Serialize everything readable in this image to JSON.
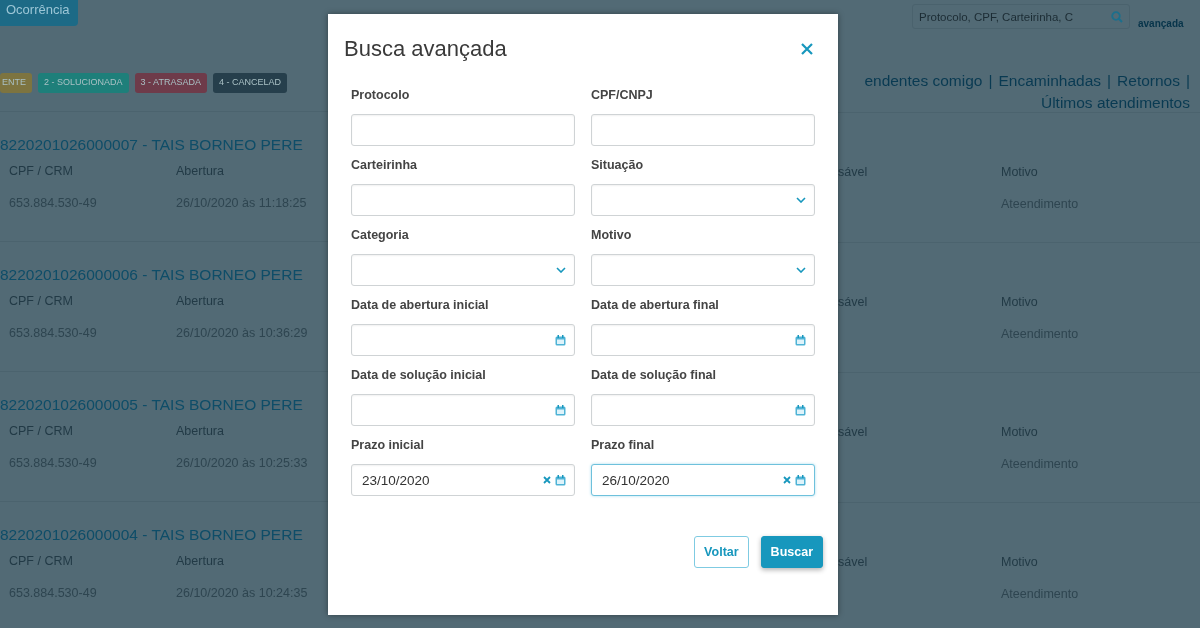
{
  "page": {
    "new_button": "Ocorrência",
    "badges": [
      {
        "label": "ENTE",
        "color": "#7d7440"
      },
      {
        "label": "2 - SOLUCIONADA",
        "color": "#1e7f7a"
      },
      {
        "label": "3 - ATRASADA",
        "color": "#6e3b4a"
      },
      {
        "label": "4 - CANCELAD",
        "color": "#263f4c"
      }
    ],
    "search": {
      "placeholder": "Protocolo, CPF, Carteirinha, C"
    },
    "advanced_link": "avançada",
    "nav": {
      "separator": "|",
      "links": [
        "endentes comigo",
        "Encaminhadas",
        "Retornos",
        "Últimos atendimentos"
      ]
    },
    "records": [
      {
        "title": "8220201026000007 - TAIS BORNEO PERE",
        "cpf_label": "CPF / CRM",
        "cpf": "653.884.530-49",
        "opened_label": "Abertura",
        "opened": "26/10/2020 às 11:18:25",
        "owner_label": "sável",
        "reason_label": "Motivo",
        "reason": "Ateendimento"
      },
      {
        "title": "8220201026000006 - TAIS BORNEO PERE",
        "cpf_label": "CPF / CRM",
        "cpf": "653.884.530-49",
        "opened_label": "Abertura",
        "opened": "26/10/2020 às 10:36:29",
        "owner_label": "sável",
        "reason_label": "Motivo",
        "reason": "Ateendimento"
      },
      {
        "title": "8220201026000005 - TAIS BORNEO PERE",
        "cpf_label": "CPF / CRM",
        "cpf": "653.884.530-49",
        "opened_label": "Abertura",
        "opened": "26/10/2020 às 10:25:33",
        "owner_label": "sável",
        "reason_label": "Motivo",
        "reason": "Ateendimento"
      },
      {
        "title": "8220201026000004 - TAIS BORNEO PERE",
        "cpf_label": "CPF / CRM",
        "cpf": "653.884.530-49",
        "opened_label": "Abertura",
        "opened": "26/10/2020 às 10:24:35",
        "owner_label": "sável",
        "reason_label": "Motivo",
        "reason": "Ateendimento"
      }
    ]
  },
  "dialog": {
    "title": "Busca avançada",
    "fields": [
      {
        "label": "Protocolo",
        "kind": "text",
        "focused": false
      },
      {
        "label": "CPF/CNPJ",
        "kind": "text",
        "focused": false
      },
      {
        "label": "Carteirinha",
        "kind": "text",
        "focused": false
      },
      {
        "label": "Situação",
        "kind": "select",
        "focused": false
      },
      {
        "label": "Categoria",
        "kind": "select",
        "focused": false
      },
      {
        "label": "Motivo",
        "kind": "select",
        "focused": false
      },
      {
        "label": "Data de abertura inicial",
        "kind": "date",
        "focused": false
      },
      {
        "label": "Data de abertura final",
        "kind": "date",
        "focused": false
      },
      {
        "label": "Data de solução inicial",
        "kind": "date",
        "focused": false
      },
      {
        "label": "Data de solução final",
        "kind": "date",
        "focused": false
      },
      {
        "label": "Prazo inicial",
        "kind": "date",
        "value": "23/10/2020",
        "focused": false
      },
      {
        "label": "Prazo final",
        "kind": "date",
        "value": "26/10/2020",
        "focused": true
      }
    ],
    "buttons": [
      {
        "label": "Voltar",
        "kind": "secondary"
      },
      {
        "label": "Buscar",
        "kind": "primary"
      }
    ]
  }
}
